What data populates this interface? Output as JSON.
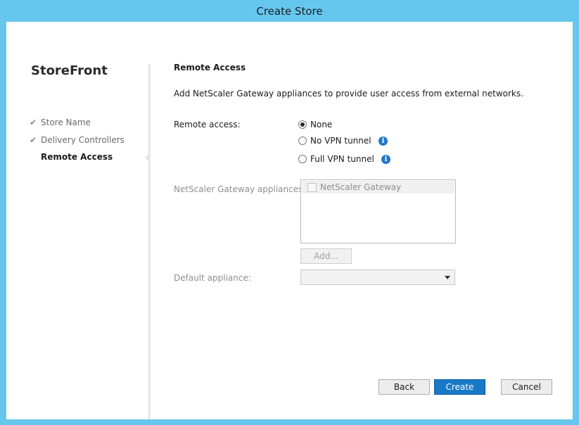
{
  "window": {
    "title": "Create Store"
  },
  "sidebar": {
    "brand": "StoreFront",
    "steps": [
      {
        "label": "Store Name",
        "completed": true,
        "active": false
      },
      {
        "label": "Delivery Controllers",
        "completed": true,
        "active": false
      },
      {
        "label": "Remote Access",
        "completed": false,
        "active": true
      }
    ]
  },
  "page": {
    "heading": "Remote Access",
    "description": "Add NetScaler Gateway appliances to provide user access from external networks."
  },
  "remote_access": {
    "label": "Remote access:",
    "options": [
      {
        "label": "None",
        "selected": true,
        "info": false
      },
      {
        "label": "No VPN tunnel",
        "selected": false,
        "info": true
      },
      {
        "label": "Full VPN tunnel",
        "selected": false,
        "info": true
      }
    ],
    "info_glyph": "i"
  },
  "gateway": {
    "label": "NetScaler Gateway appliances:",
    "items": [
      {
        "label": "NetScaler Gateway",
        "checked": false
      }
    ],
    "add_label": "Add..."
  },
  "default_appliance": {
    "label": "Default appliance:",
    "value": ""
  },
  "footer": {
    "back_label": "Back",
    "create_label": "Create",
    "cancel_label": "Cancel"
  },
  "colors": {
    "titlebar": "#66c7ee",
    "primary_button": "#1879c7",
    "info_icon": "#1e78c8"
  }
}
